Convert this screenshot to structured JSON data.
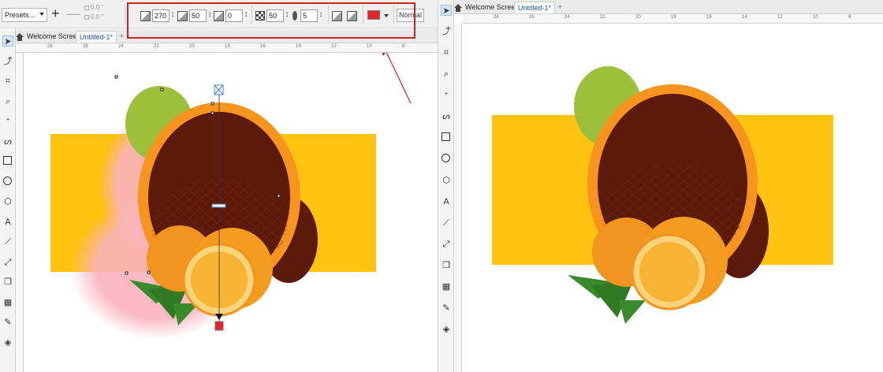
{
  "property_bar": {
    "presets_label": "Presets...",
    "mini_x": "0.0 \"",
    "mini_y": "0.0 \"",
    "shadow_angle": "270",
    "shadow_opacity": "50",
    "shadow_stretch": "0",
    "shadow_fade": "50",
    "shadow_feather": "5",
    "shadow_color": "#e52329",
    "merge_mode": "Normal"
  },
  "tabs": {
    "welcome": "Welcome Screen",
    "document": "Untitled-1*",
    "add": "+"
  },
  "ruler": {
    "left_ticks": [
      "28",
      "26",
      "24",
      "22",
      "20",
      "18",
      "16",
      "14",
      "12",
      "10",
      "8"
    ],
    "right_ticks": [
      "28",
      "26",
      "24",
      "22",
      "20",
      "18",
      "16",
      "14",
      "12",
      "10",
      "8"
    ]
  },
  "tools": [
    "pick-tool",
    "shape-tool",
    "crop-tool",
    "zoom-tool",
    "freehand-tool",
    "artistic-media-tool",
    "rectangle-tool",
    "ellipse-tool",
    "polygon-tool",
    "text-tool",
    "parallel-dimension-tool",
    "connector-tool",
    "drop-shadow-tool",
    "transparency-tool",
    "color-eyedropper-tool",
    "interactive-fill-tool"
  ],
  "colors": {
    "banner_yellow": "#ffc20e",
    "orange_ring": "#f7941d",
    "dark_brown": "#5c1a0b",
    "lime_green": "#9dc03a",
    "shadow_red": "#e52329",
    "highlight_red": "#d11f26"
  }
}
